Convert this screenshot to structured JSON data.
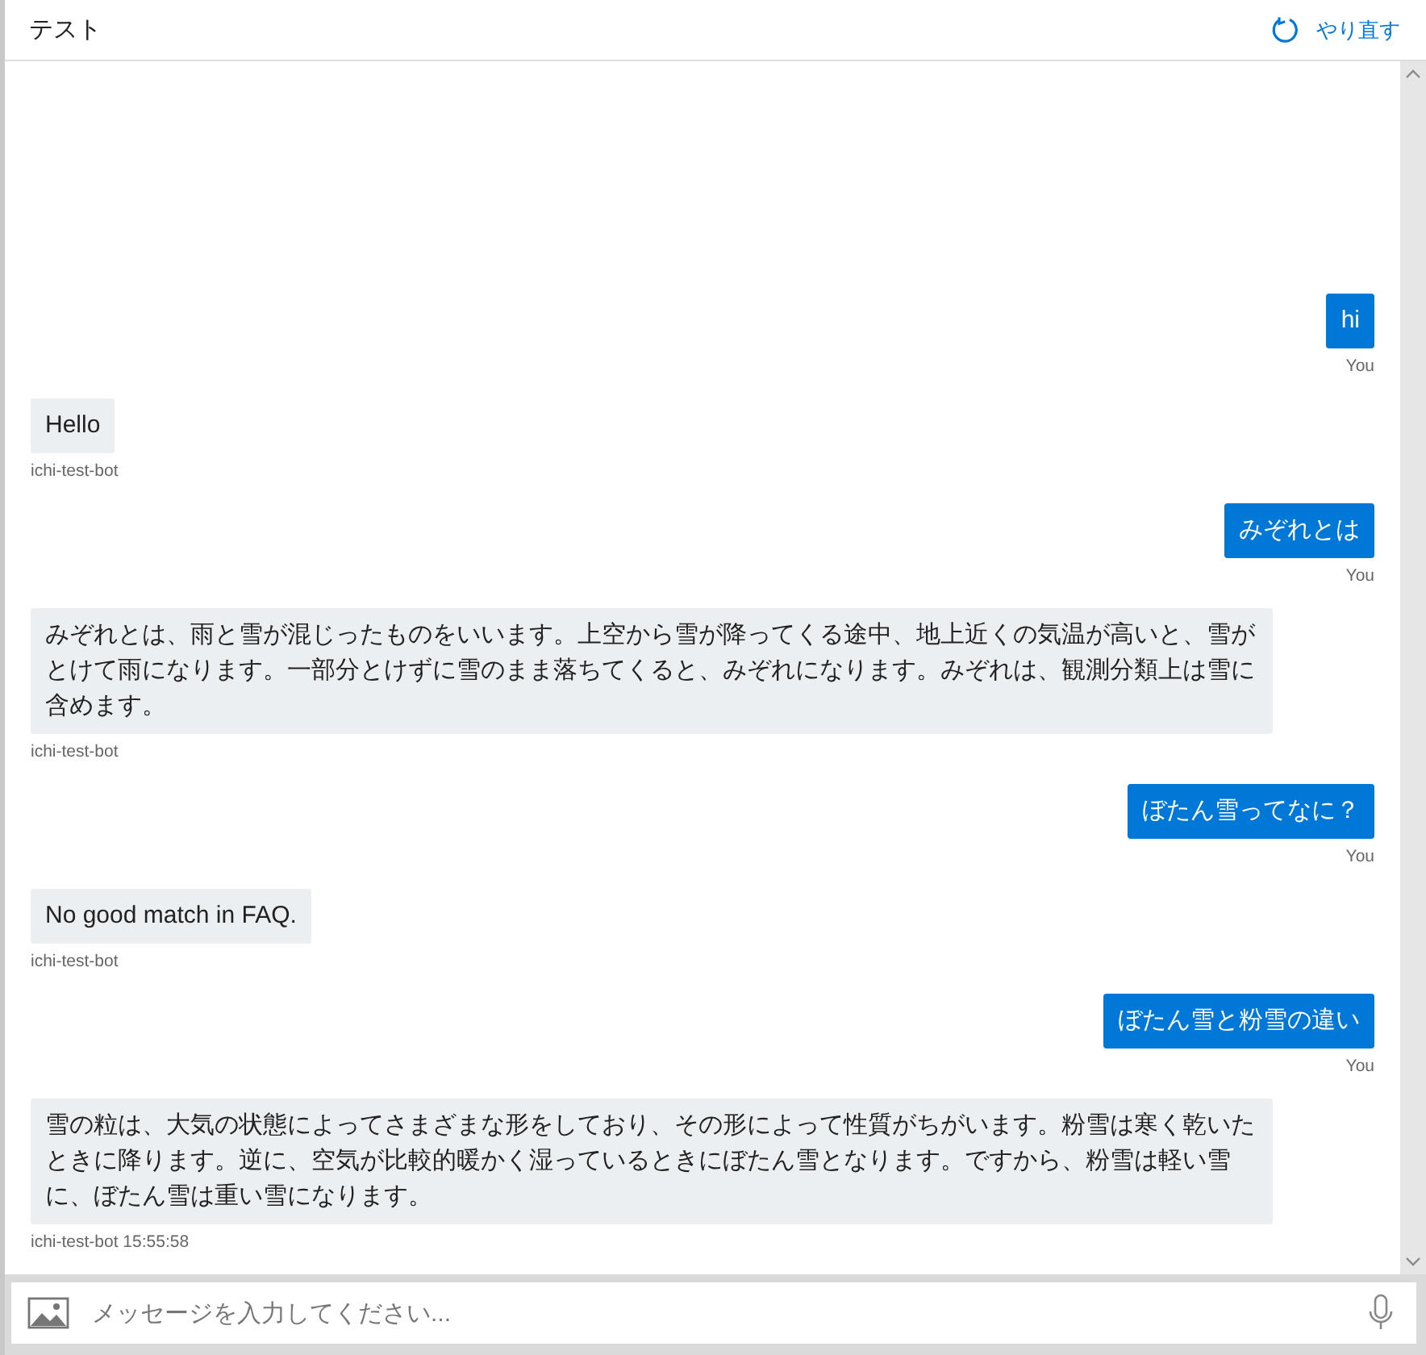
{
  "header": {
    "title": "テスト",
    "restart_label": "やり直す"
  },
  "messages": [
    {
      "kind": "user",
      "text": "hi",
      "caption": "You"
    },
    {
      "kind": "bot",
      "text": "Hello",
      "caption": "ichi-test-bot"
    },
    {
      "kind": "user",
      "text": "みぞれとは",
      "caption": "You"
    },
    {
      "kind": "bot",
      "text": "みぞれとは、雨と雪が混じったものをいいます。上空から雪が降ってくる途中、地上近くの気温が高いと、雪がとけて雨になります。一部分とけずに雪のまま落ちてくると、みぞれになります。みぞれは、観測分類上は雪に含めます。",
      "caption": "ichi-test-bot"
    },
    {
      "kind": "user",
      "text": "ぼたん雪ってなに？",
      "caption": "You"
    },
    {
      "kind": "bot",
      "text": "No good match in FAQ.",
      "caption": "ichi-test-bot"
    },
    {
      "kind": "user",
      "text": "ぼたん雪と粉雪の違い",
      "caption": "You"
    },
    {
      "kind": "bot",
      "text": "雪の粒は、大気の状態によってさまざまな形をしており、その形によって性質がちがいます。粉雪は寒く乾いたときに降ります。逆に、空気が比較的暖かく湿っているときにぼたん雪となります。ですから、粉雪は軽い雪に、ぼたん雪は重い雪になります。",
      "caption": "ichi-test-bot 15:55:58"
    }
  ],
  "composer": {
    "placeholder": "メッセージを入力してください..."
  }
}
